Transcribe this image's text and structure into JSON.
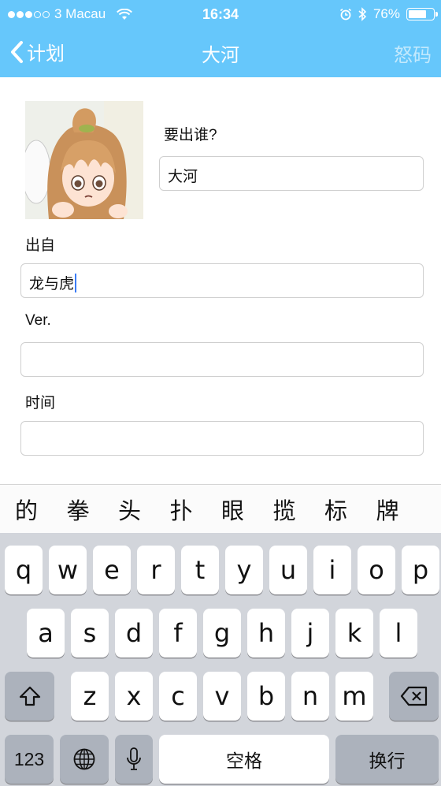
{
  "status_bar": {
    "carrier": "3 Macau",
    "time": "16:34",
    "battery_percent": "76%",
    "battery_level": 0.76,
    "icons": [
      "signal-dots-icon",
      "wifi-icon",
      "alarm-icon",
      "bluetooth-icon",
      "battery-icon"
    ]
  },
  "nav": {
    "back_label": "计划",
    "title": "大河",
    "right_label": "怒码"
  },
  "form": {
    "avatar_icon": "character-avatar-image",
    "who_label": "要出谁?",
    "who_value": "大河",
    "source_label": "出自",
    "source_value": "龙与虎",
    "ver_label": "Ver.",
    "ver_value": "",
    "time_label": "时间",
    "time_value": ""
  },
  "keyboard": {
    "candidates": [
      "的",
      "拳",
      "头",
      "扑",
      "眼",
      "揽",
      "标",
      "牌"
    ],
    "row1": [
      "q",
      "w",
      "e",
      "r",
      "t",
      "y",
      "u",
      "i",
      "o",
      "p"
    ],
    "row2": [
      "a",
      "s",
      "d",
      "f",
      "g",
      "h",
      "j",
      "k",
      "l"
    ],
    "row3": [
      "z",
      "x",
      "c",
      "v",
      "b",
      "n",
      "m"
    ],
    "numbers_key": "123",
    "space_key": "空格",
    "return_key": "换行",
    "key_icons": [
      "shift-icon",
      "backspace-icon",
      "globe-icon",
      "microphone-icon"
    ]
  }
}
